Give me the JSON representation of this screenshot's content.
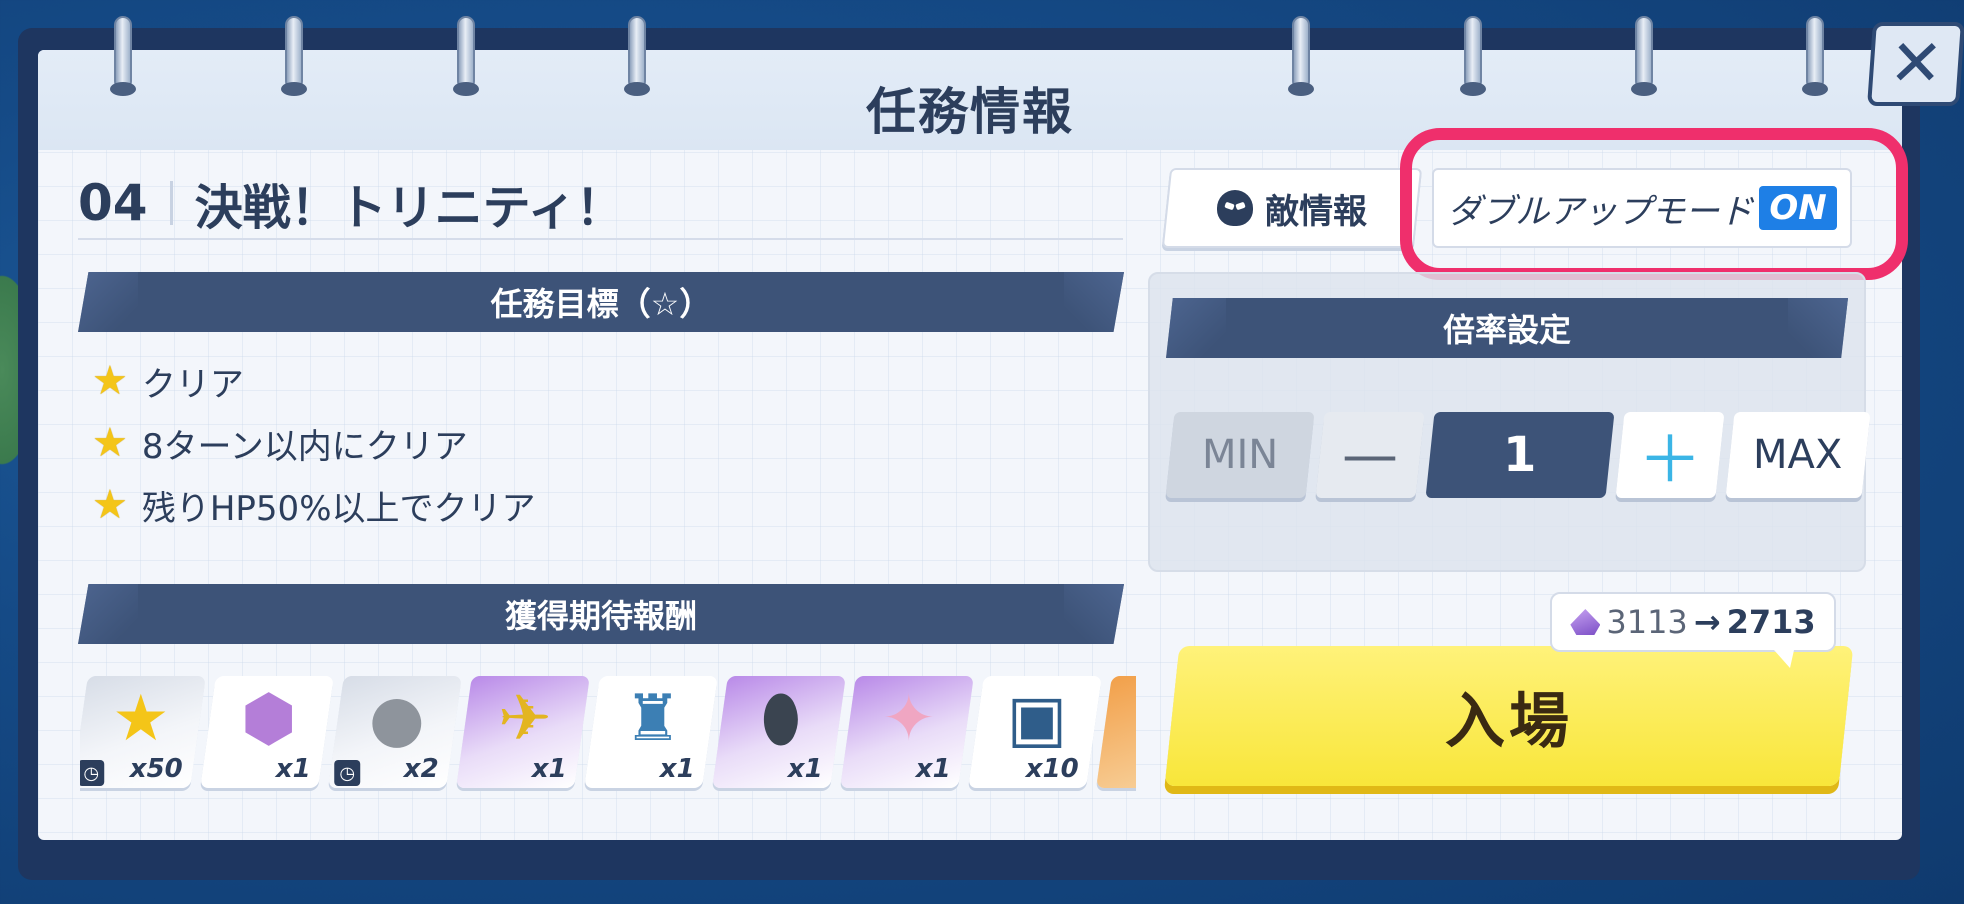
{
  "window": {
    "title": "任務情報",
    "close_symbol": "✕"
  },
  "stage": {
    "number": "04",
    "name": "決戦！トリニティ！"
  },
  "objectives": {
    "header": "任務目標（☆）",
    "items": [
      "クリア",
      "8ターン以内にクリア",
      "残りHP50%以上でクリア"
    ]
  },
  "rewards": {
    "header": "獲得期待報酬",
    "items": [
      {
        "icon": "gold-star-icon",
        "glyph": "★",
        "qty": "x50",
        "timed": true,
        "style": "grey",
        "color": "#f4c518"
      },
      {
        "icon": "student-portrait-icon",
        "glyph": "⬢",
        "qty": "x1",
        "timed": false,
        "style": "plain",
        "color": "#b47ed8"
      },
      {
        "icon": "stone-icon",
        "glyph": "●",
        "qty": "x2",
        "timed": true,
        "style": "grey",
        "color": "#8e949c"
      },
      {
        "icon": "golden-artifact-icon",
        "glyph": "✈",
        "qty": "x1",
        "timed": false,
        "style": "purple",
        "color": "#e3b521"
      },
      {
        "icon": "totem-icon",
        "glyph": "♜",
        "qty": "x1",
        "timed": false,
        "style": "plain",
        "color": "#3c7fb4"
      },
      {
        "icon": "dark-egg-icon",
        "glyph": "⬮",
        "qty": "x1",
        "timed": false,
        "style": "purple",
        "color": "#3a4450"
      },
      {
        "icon": "pink-fragment-icon",
        "glyph": "✦",
        "qty": "x1",
        "timed": false,
        "style": "purple",
        "color": "#f0a6c2"
      },
      {
        "icon": "mystery-chest-icon",
        "glyph": "▣",
        "qty": "x10",
        "timed": false,
        "style": "plain",
        "color": "#2f5d8a"
      },
      {
        "icon": "partial-item-icon",
        "glyph": "◆",
        "qty": "",
        "timed": false,
        "style": "orange",
        "color": "#e07a22"
      }
    ]
  },
  "enemy_info": {
    "label": "敵情報"
  },
  "double_up": {
    "label": "ダブルアップモード",
    "state": "ON"
  },
  "rate": {
    "header": "倍率設定",
    "min_label": "MIN",
    "minus_label": "—",
    "value": "1",
    "plus_label": "＋",
    "max_label": "MAX"
  },
  "cost": {
    "from": "3113",
    "arrow": "→",
    "to": "2713"
  },
  "enter": {
    "label": "入場"
  },
  "colors": {
    "accent_highlight": "#ef2f6c",
    "on_badge": "#1e7fe6",
    "enter_button": "#f8e63a",
    "banner": "#3d5378"
  }
}
